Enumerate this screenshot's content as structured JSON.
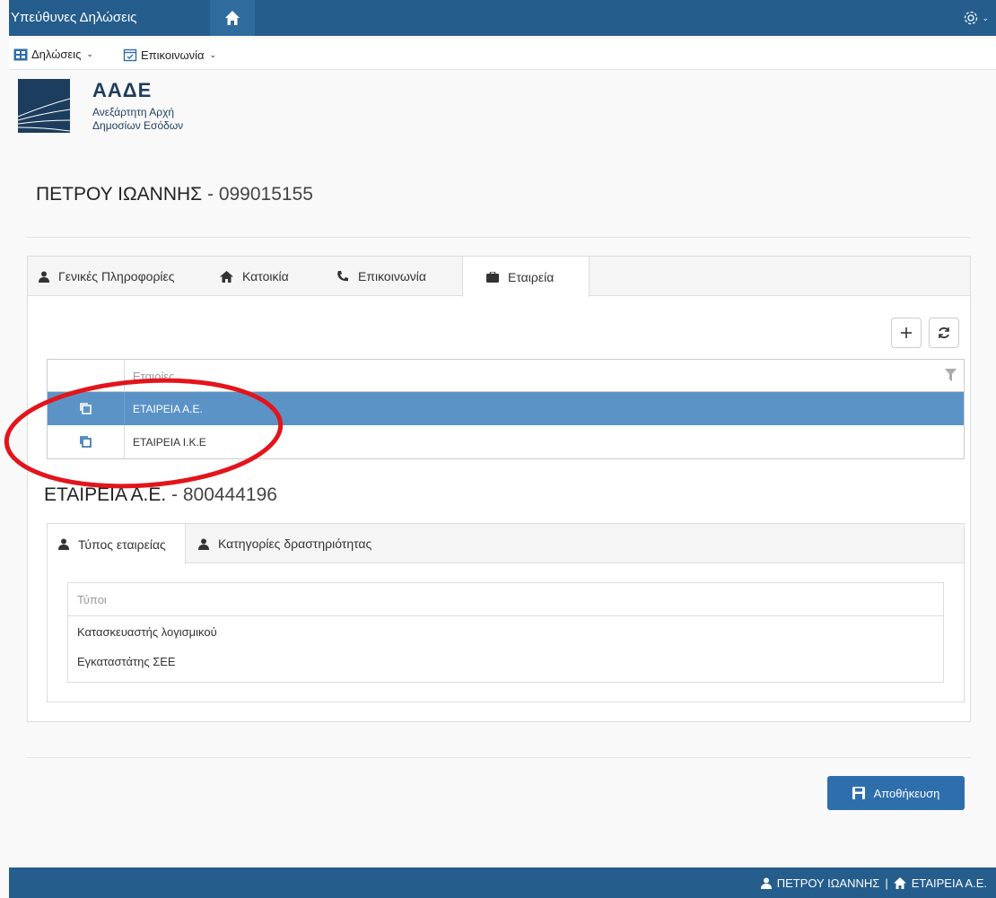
{
  "app": {
    "title": "Υπεύθυνες Δηλώσεις"
  },
  "menu": {
    "items": [
      {
        "label": "Δηλώσεις",
        "icon": "grid-icon"
      },
      {
        "label": "Επικοινωνία",
        "icon": "calendar-check-icon"
      }
    ]
  },
  "logo": {
    "abbr": "ΑΑΔΕ",
    "line1": "Ανεξάρτητη Αρχή",
    "line2": "Δημοσίων Εσόδων"
  },
  "person": {
    "name": "ΠΕΤΡΟΥ ΙΩΑΝΝΗΣ",
    "afm": " - 099015155"
  },
  "tabs": [
    {
      "label": "Γενικές Πληροφορίες",
      "icon": "user-icon"
    },
    {
      "label": "Κατοικία",
      "icon": "home-icon"
    },
    {
      "label": "Επικοινωνία",
      "icon": "phone-icon"
    },
    {
      "label": "Εταιρεία",
      "icon": "briefcase-icon",
      "active": true
    }
  ],
  "companies": {
    "header": "Εταιρίες",
    "rows": [
      {
        "name": "ΕΤΑΙΡΕΙΑ Α.Ε.",
        "selected": true
      },
      {
        "name": "ΕΤΑΙΡΕΙΑ Ι.Κ.Ε",
        "selected": false
      }
    ]
  },
  "company_detail": {
    "name": "ΕΤΑΙΡΕΙΑ Α.Ε.",
    "afm": " - 800444196",
    "tabs": [
      {
        "label": "Τύπος εταιρείας",
        "icon": "user-icon",
        "active": true
      },
      {
        "label": "Κατηγορίες δραστηριότητας",
        "icon": "user-icon"
      }
    ],
    "types_header": "Τύποι",
    "types": [
      "Κατασκευαστής λογισμικού",
      "Εγκαταστάτης ΣΕΕ"
    ]
  },
  "save_label": "Αποθήκευση",
  "footer": {
    "user": "ΠΕΤΡΟΥ ΙΩΑΝΝΗΣ",
    "separator": "|",
    "company": "ΕΤΑΙΡΕΙΑ Α.Ε."
  },
  "colors": {
    "primary": "#255d8c",
    "selected_row": "#5b93c7",
    "button": "#2e6eac",
    "annotation": "#e3141b"
  }
}
